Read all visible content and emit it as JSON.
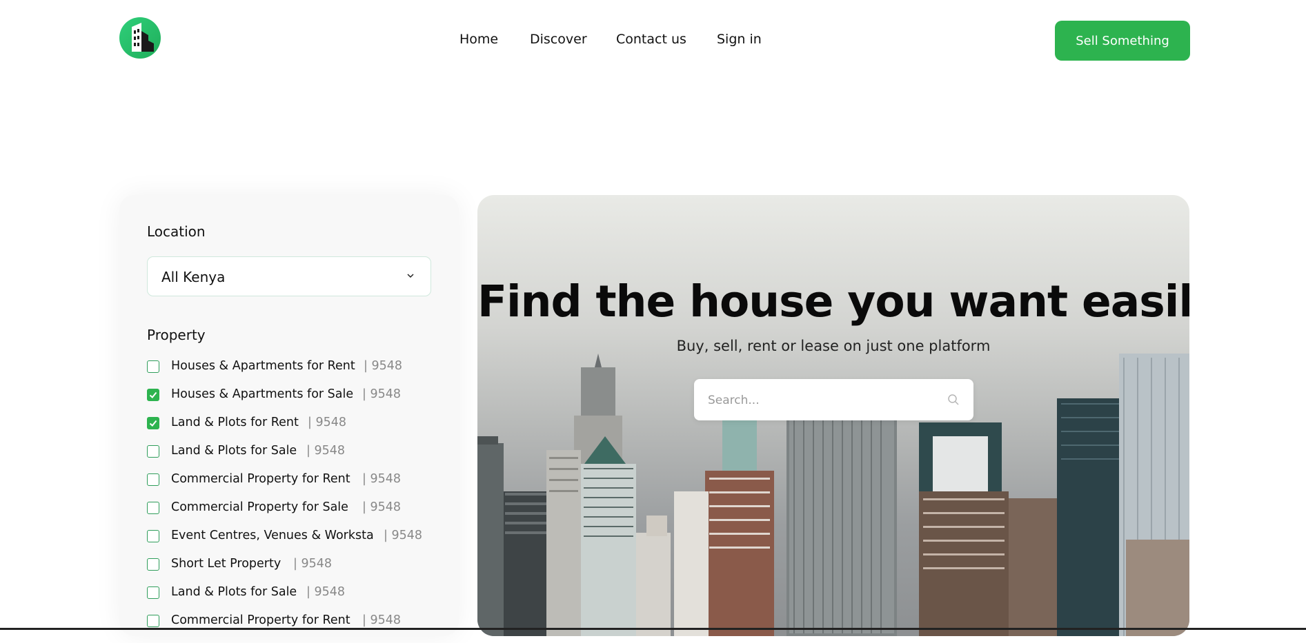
{
  "header": {
    "logo_icon": "building-logo-icon",
    "nav": {
      "home": "Home",
      "discover": "Discover",
      "contact": "Contact us",
      "signin": "Sign in"
    },
    "sell_button": "Sell Something"
  },
  "sidebar": {
    "location_label": "Location",
    "location_value": "All Kenya",
    "property_label": "Property",
    "items": [
      {
        "label": "Houses & Apartments for Rent",
        "count": "| 9548",
        "checked": false
      },
      {
        "label": "Houses & Apartments for Sale",
        "count": "| 9548",
        "checked": true
      },
      {
        "label": "Land & Plots for Rent",
        "count": "| 9548",
        "checked": true
      },
      {
        "label": "Land & Plots for Sale",
        "count": "| 9548",
        "checked": false
      },
      {
        "label": "Commercial Property for Rent",
        "count": "| 9548",
        "checked": false
      },
      {
        "label": "Commercial Property for Sale",
        "count": "| 9548",
        "checked": false
      },
      {
        "label": "Event Centres, Venues & Worksta",
        "count": "| 9548",
        "checked": false
      },
      {
        "label": "Short Let Property",
        "count": "| 9548",
        "checked": false
      },
      {
        "label": "Land & Plots for Sale",
        "count": "| 9548",
        "checked": false
      },
      {
        "label": "Commercial Property for Rent",
        "count": "| 9548",
        "checked": false
      }
    ]
  },
  "hero": {
    "title": "Find the house you want easily",
    "subtitle": "Buy, sell, rent or lease on just one platform",
    "search_placeholder": "Search..."
  },
  "colors": {
    "accent": "#2db34f",
    "logo": "#22c26a"
  }
}
